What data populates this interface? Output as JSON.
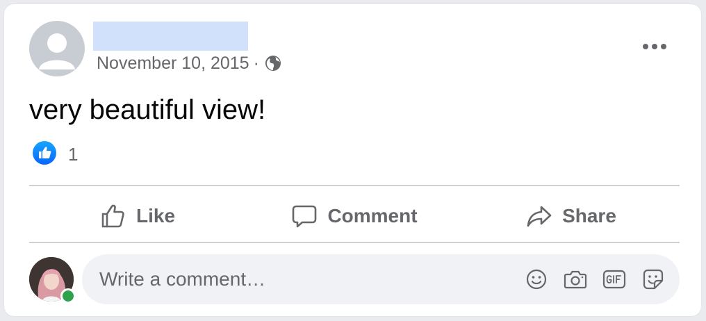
{
  "post": {
    "date": "November 10, 2015",
    "separator": "·",
    "text": "very beautiful view!",
    "privacy_icon": "globe-icon",
    "menu_icon": "more-horizontal-icon"
  },
  "reactions": {
    "icon": "like-reaction-icon",
    "count": "1"
  },
  "actions": {
    "like_label": "Like",
    "comment_label": "Comment",
    "share_label": "Share"
  },
  "composer": {
    "placeholder": "Write a comment…",
    "value": "",
    "icons": [
      "emoji-icon",
      "camera-icon",
      "gif-icon",
      "sticker-icon"
    ]
  },
  "colors": {
    "accent_blue": "#1877f2",
    "secondary_text": "#65676b",
    "online_green": "#31a24c",
    "redaction": "#d2e1fb"
  }
}
